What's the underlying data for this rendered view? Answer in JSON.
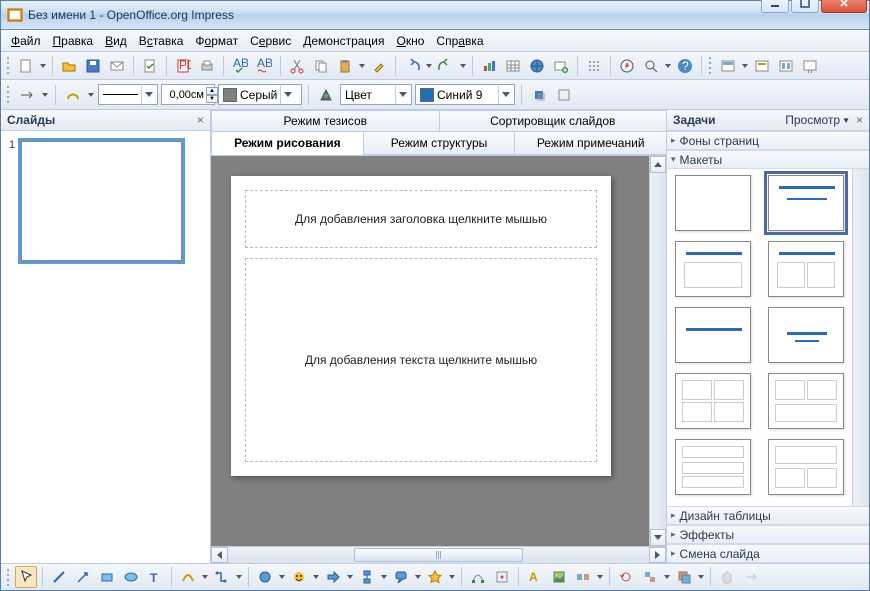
{
  "title": "Без имени 1 - OpenOffice.org Impress",
  "menu": [
    "Файл",
    "Правка",
    "Вид",
    "Вставка",
    "Формат",
    "Сервис",
    "Демонстрация",
    "Окно",
    "Справка"
  ],
  "menu_accel": [
    0,
    0,
    0,
    1,
    0,
    0,
    0,
    0,
    0
  ],
  "toolbar2": {
    "line_width": "0,00см",
    "fill_color_name": "Серый",
    "fill_color_hex": "#808080",
    "fill_type": "Цвет",
    "line_color_name": "Синий 9",
    "line_color_hex": "#1f6fb5"
  },
  "slides_panel": {
    "title": "Слайды"
  },
  "view_tabs_top": [
    "Режим тезисов",
    "Сортировщик слайдов"
  ],
  "view_tabs_bottom": [
    "Режим рисования",
    "Режим структуры",
    "Режим примечаний"
  ],
  "active_view_tab": 0,
  "slide": {
    "title_placeholder": "Для добавления заголовка щелкните мышью",
    "body_placeholder": "Для добавления текста щелкните мышью"
  },
  "task_panel": {
    "title": "Задачи",
    "view_label": "Просмотр",
    "sections": [
      "Фоны страниц",
      "Макеты",
      "Дизайн таблицы",
      "Эффекты",
      "Смена слайда"
    ],
    "open_section": 1,
    "selected_layout": 1
  },
  "slide_numbers": [
    "1"
  ]
}
